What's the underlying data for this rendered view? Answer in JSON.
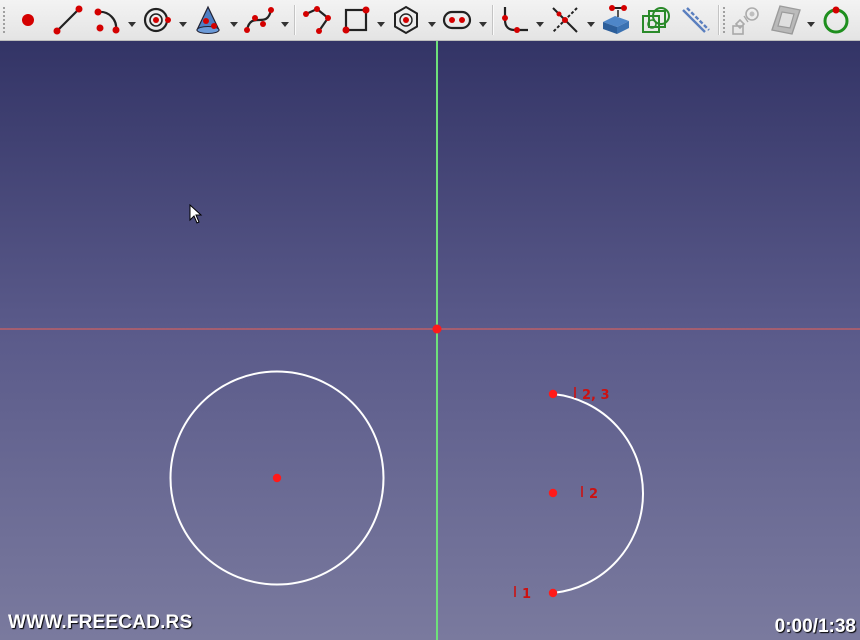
{
  "toolbar": {
    "tools": [
      {
        "icon": "sketch-point-icon"
      },
      {
        "icon": "sketch-line-icon"
      },
      {
        "icon": "sketch-arc-icon"
      },
      {
        "icon": "sketch-circle-icon"
      },
      {
        "icon": "sketch-conic-icon"
      },
      {
        "icon": "sketch-bspline-icon"
      },
      {
        "icon": "sketch-polyline-icon"
      },
      {
        "icon": "sketch-rectangle-icon"
      },
      {
        "icon": "sketch-polygon-icon"
      },
      {
        "icon": "sketch-slot-icon"
      },
      {
        "icon": "sketch-fillet-icon"
      },
      {
        "icon": "sketch-trim-icon"
      },
      {
        "icon": "sketch-external-geometry-icon"
      },
      {
        "icon": "sketch-carbon-copy-icon"
      },
      {
        "icon": "sketch-construction-toggle-icon"
      },
      {
        "icon": "sketch-symmetry-icon"
      },
      {
        "icon": "sketch-array-icon"
      },
      {
        "icon": "sketch-close-shape-icon"
      }
    ]
  },
  "viewport": {
    "labels": {
      "arc_start": "2, 3",
      "arc_center": "2",
      "arc_end": "1"
    }
  },
  "overlay": {
    "watermark": "WWW.FREECAD.RS",
    "timer": "0:00/1:38"
  },
  "colors": {
    "vertical_axis": "#6ee07a",
    "horizontal_axis": "#d06060",
    "point": "#ff1a1a",
    "geometry": "#ffffff",
    "label": "#cc1111"
  }
}
